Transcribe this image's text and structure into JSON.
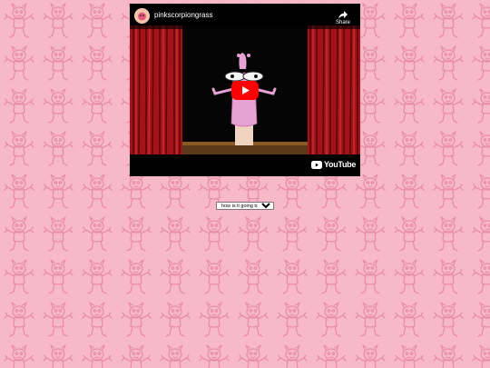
{
  "video": {
    "channel_name": "pinkscorpiongrass",
    "share_label": "Share",
    "brand": "YouTube"
  },
  "mood_select": {
    "selected": "how is it going today?"
  },
  "colors": {
    "page_bg": "#f7b8c8",
    "pattern_line": "#e78fa6",
    "curtain": "#b0151c",
    "puppet": "#e7a2d4",
    "play_red": "#ff0000"
  },
  "icons": {
    "share": "share-icon",
    "play": "play-icon",
    "background": "pink-creature-pattern"
  }
}
